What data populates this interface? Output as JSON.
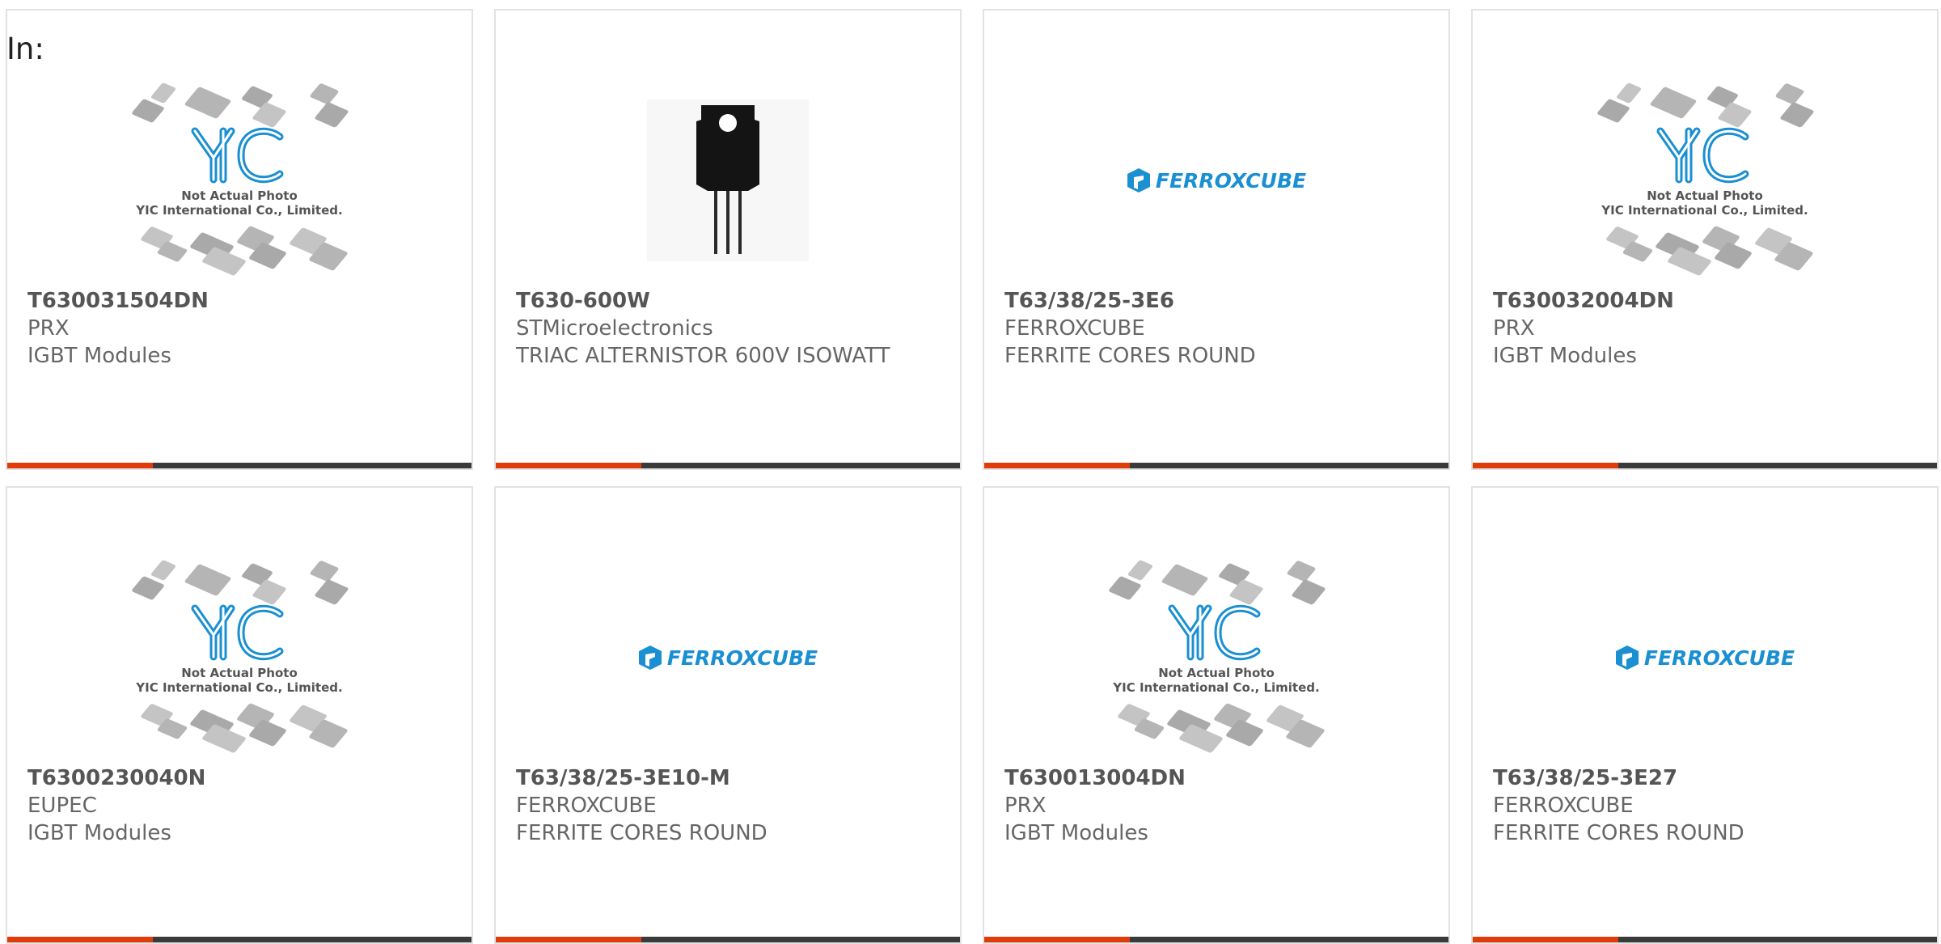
{
  "header": {
    "in_label": "In:"
  },
  "products": [
    {
      "part_number": "T630031504DN",
      "manufacturer": "PRX",
      "description": "IGBT Modules",
      "image": "yic-placeholder"
    },
    {
      "part_number": "T630-600W",
      "manufacturer": "STMicroelectronics",
      "description": "TRIAC ALTERNISTOR 600V ISOWATT",
      "image": "to220-package"
    },
    {
      "part_number": "T63/38/25-3E6",
      "manufacturer": "FERROXCUBE",
      "description": "FERRITE CORES ROUND",
      "image": "ferroxcube-logo"
    },
    {
      "part_number": "T630032004DN",
      "manufacturer": "PRX",
      "description": "IGBT Modules",
      "image": "yic-placeholder"
    },
    {
      "part_number": "T6300230040N",
      "manufacturer": "EUPEC",
      "description": "IGBT Modules",
      "image": "yic-placeholder"
    },
    {
      "part_number": "T63/38/25-3E10-M",
      "manufacturer": "FERROXCUBE",
      "description": "FERRITE CORES ROUND",
      "image": "ferroxcube-logo"
    },
    {
      "part_number": "T630013004DN",
      "manufacturer": "PRX",
      "description": "IGBT Modules",
      "image": "yic-placeholder"
    },
    {
      "part_number": "T63/38/25-3E27",
      "manufacturer": "FERROXCUBE",
      "description": "FERRITE CORES ROUND",
      "image": "ferroxcube-logo"
    }
  ],
  "placeholder": {
    "line1": "Not Actual Photo",
    "line2": "YIC International Co., Limited.",
    "logo_text": "YIC"
  },
  "ferroxcube_logo_text": "FERROXCUBE",
  "colors": {
    "accent": "#e03c0a",
    "bar": "#3a3a3a",
    "border": "#e2e2e2",
    "brand_blue": "#1a8fd1",
    "text_gray": "#666666"
  }
}
